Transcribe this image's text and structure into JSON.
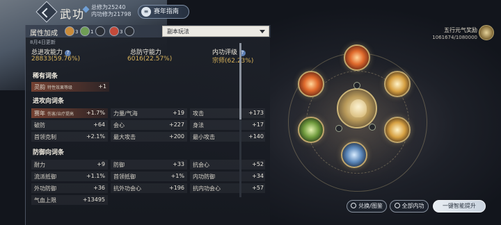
{
  "header": {
    "title": "武功",
    "total_power": "总修为25240",
    "neigong_power": "内功修为21798",
    "guide_button": "赛年指南"
  },
  "panel": {
    "title": "属性加成",
    "buffs": [
      {
        "count": "3",
        "color": "#c98b3a"
      },
      {
        "count": "1",
        "color": "#6f9d55"
      },
      {
        "count": "",
        "color": "#2b2f36"
      },
      {
        "count": "3",
        "color": "#c34a3a"
      },
      {
        "count": "",
        "color": "#2b2f36"
      }
    ],
    "mode_select": "副本玩法",
    "update_text": "8月4日更新",
    "summary": [
      {
        "label": "总进攻能力",
        "value": "28833(59.76%)",
        "help": "?"
      },
      {
        "label": "总防守能力",
        "value": "6016(22.57%)"
      },
      {
        "label": "内功评级",
        "value": "宗师(62.23%)",
        "help": "?"
      }
    ],
    "sections": {
      "rare": {
        "title": "稀有词条",
        "items": [
          {
            "name": "灵韵",
            "sub": "特性效果等级",
            "value": "+1"
          }
        ]
      },
      "attack": {
        "title": "进攻向词条",
        "rows": [
          [
            {
              "name": "赛年",
              "sub": "伤害/治疗提高",
              "value": "+1.7%"
            },
            {
              "name": "力量/气海",
              "value": "+19"
            },
            {
              "name": "攻击",
              "value": "+173"
            }
          ],
          [
            {
              "name": "破防",
              "value": "+64"
            },
            {
              "name": "会心",
              "value": "+227"
            },
            {
              "name": "身法",
              "value": "+17"
            }
          ],
          [
            {
              "name": "首领克制",
              "value": "+2.1%"
            },
            {
              "name": "最大攻击",
              "value": "+200"
            },
            {
              "name": "最小攻击",
              "value": "+140"
            }
          ]
        ]
      },
      "defense": {
        "title": "防御向词条",
        "rows": [
          [
            {
              "name": "耐力",
              "value": "+9"
            },
            {
              "name": "防御",
              "value": "+33"
            },
            {
              "name": "抗会心",
              "value": "+52"
            }
          ],
          [
            {
              "name": "流派抵御",
              "value": "+1.1%"
            },
            {
              "name": "首领抵御",
              "value": "+1%"
            },
            {
              "name": "内功防御",
              "value": "+34"
            }
          ],
          [
            {
              "name": "外功防御",
              "value": "+36"
            },
            {
              "name": "抗外功会心",
              "value": "+196"
            },
            {
              "name": "抗内功会心",
              "value": "+57"
            }
          ],
          [
            {
              "name": "气血上限",
              "value": "+13495"
            }
          ]
        ]
      }
    }
  },
  "reward": {
    "title": "五行元气奖励",
    "progress": "1061674/1080000"
  },
  "buttons": {
    "exchange": "兑换/图鉴",
    "all_neigong": "全部内功",
    "smart_upgrade": "一键智能提升"
  },
  "colors": {
    "accent_gold": "#d8b25a",
    "highlight": "#bc5c3a"
  }
}
